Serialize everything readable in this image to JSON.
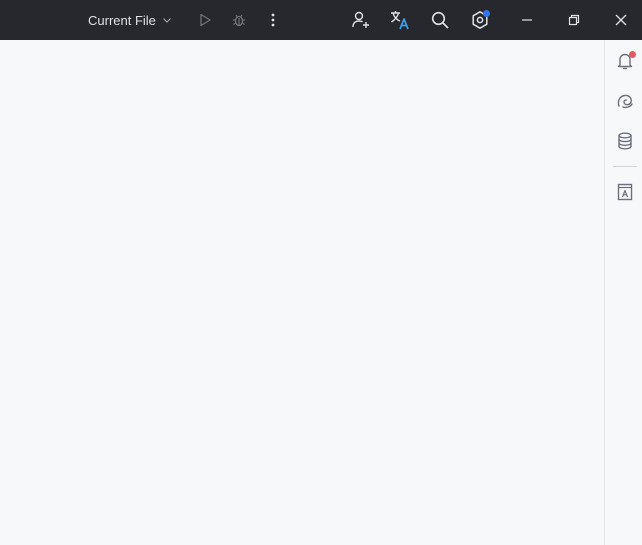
{
  "titlebar": {
    "run_config": {
      "label": "Current File",
      "icon": "chevron-down-icon"
    },
    "actions": [
      {
        "name": "run-button",
        "icon": "play-icon",
        "enabled": false
      },
      {
        "name": "debug-button",
        "icon": "bug-icon",
        "enabled": false
      },
      {
        "name": "more-actions-button",
        "icon": "more-vertical-icon"
      },
      {
        "name": "code-with-me-button",
        "icon": "add-user-icon"
      },
      {
        "name": "translate-button",
        "icon": "translate-icon"
      },
      {
        "name": "search-everywhere-button",
        "icon": "search-icon"
      },
      {
        "name": "settings-button",
        "icon": "gear-icon",
        "badge_color": "#3574f0"
      }
    ],
    "window_controls": [
      {
        "name": "minimize-button",
        "icon": "minimize-icon"
      },
      {
        "name": "restore-button",
        "icon": "restore-icon"
      },
      {
        "name": "close-button",
        "icon": "close-icon"
      }
    ]
  },
  "right_toolbar": {
    "items": [
      {
        "name": "notifications-button",
        "icon": "bell-icon",
        "badge_color": "#e55765"
      },
      {
        "name": "ai-assistant-button",
        "icon": "ai-spiral-icon"
      },
      {
        "name": "database-button",
        "icon": "database-icon"
      },
      {
        "name": "font-viewer-button",
        "icon": "font-book-icon"
      }
    ]
  },
  "colors": {
    "titlebar_bg": "#27282e",
    "titlebar_icon": "#dfe1e5",
    "disabled_icon": "#6f737a",
    "editor_bg": "#f7f8fa",
    "strip_icon": "#6c707e"
  }
}
